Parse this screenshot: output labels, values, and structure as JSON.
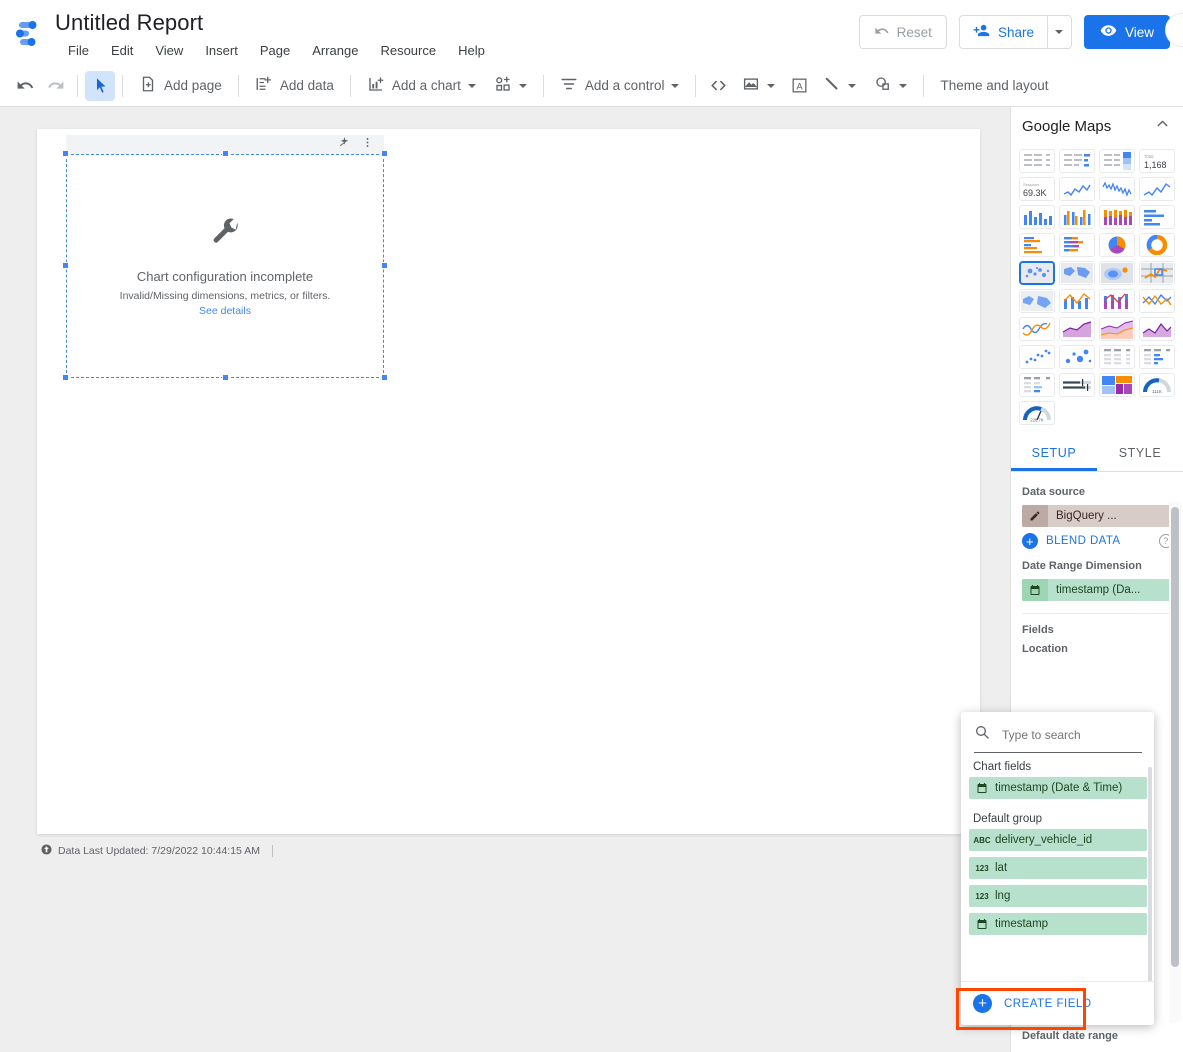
{
  "app": {
    "logo_icon": "looker-studio-logo",
    "title": "Untitled Report",
    "menu": [
      "File",
      "Edit",
      "View",
      "Insert",
      "Page",
      "Arrange",
      "Resource",
      "Help"
    ],
    "buttons": {
      "reset": "Reset",
      "reset_icon": "undo-arrow-icon",
      "share": "Share",
      "share_icon": "person-add-icon",
      "share_caret_icon": "chevron-down-icon",
      "view": "View",
      "view_icon": "eye-icon",
      "avatar_icon": "user-avatar"
    }
  },
  "toolbar": {
    "undo_icon": "undo-icon",
    "redo_icon": "redo-icon",
    "select_icon": "cursor-arrow-icon",
    "add_page": "Add page",
    "add_page_icon": "page-add-icon",
    "add_data": "Add data",
    "add_data_icon": "database-add-icon",
    "add_chart": "Add a chart",
    "add_chart_icon": "bar-chart-add-icon",
    "community_viz_icon": "community-visualization-icon",
    "add_control": "Add a control",
    "add_control_icon": "filter-control-icon",
    "embed_icon": "embed-code-icon",
    "image_icon": "image-icon",
    "text_icon": "text-box-icon",
    "line_icon": "line-icon",
    "shape_icon": "shape-icon",
    "theme_layout": "Theme and layout"
  },
  "canvas": {
    "chart_widget": {
      "magic_icon": "sparkle-wand-icon",
      "more_icon": "more-vert-icon",
      "placeholder_icon": "wrench-icon",
      "title": "Chart configuration incomplete",
      "subtitle": "Invalid/Missing dimensions, metrics, or filters.",
      "link": "See details"
    },
    "footer": {
      "icon": "refresh-data-icon",
      "text": "Data Last Updated: 7/29/2022 10:44:15 AM"
    }
  },
  "right_panel": {
    "header": {
      "title": "Google Maps",
      "collapse_icon": "chevron-up-icon"
    },
    "gallery": [
      {
        "name": "table",
        "selected": false
      },
      {
        "name": "table-with-bars",
        "selected": false
      },
      {
        "name": "table-with-heatmap",
        "selected": false
      },
      {
        "name": "scorecard-total",
        "selected": false,
        "label_top": "Total",
        "label_value": "1,168"
      },
      {
        "name": "scorecard-sessions",
        "selected": false,
        "label_top": "Sessions",
        "label_value": "69.3K"
      },
      {
        "name": "time-series-line",
        "selected": false
      },
      {
        "name": "time-series-multi",
        "selected": false
      },
      {
        "name": "sparkline",
        "selected": false
      },
      {
        "name": "column-chart",
        "selected": false
      },
      {
        "name": "column-chart-grouped",
        "selected": false
      },
      {
        "name": "stacked-column-chart",
        "selected": false
      },
      {
        "name": "bar-chart",
        "selected": false
      },
      {
        "name": "bar-chart-grouped",
        "selected": false
      },
      {
        "name": "stacked-bar-chart",
        "selected": false
      },
      {
        "name": "pie-chart",
        "selected": false
      },
      {
        "name": "donut-chart",
        "selected": false
      },
      {
        "name": "bubble-map",
        "selected": true
      },
      {
        "name": "filled-map",
        "selected": false
      },
      {
        "name": "google-maps-heatmap",
        "selected": false
      },
      {
        "name": "google-maps-line",
        "selected": false
      },
      {
        "name": "google-maps-filled",
        "selected": false
      },
      {
        "name": "combo-chart",
        "selected": false
      },
      {
        "name": "combo-stacked-chart",
        "selected": false
      },
      {
        "name": "line-chart",
        "selected": false
      },
      {
        "name": "smoothed-line-chart",
        "selected": false
      },
      {
        "name": "area-chart",
        "selected": false
      },
      {
        "name": "stacked-area-chart",
        "selected": false
      },
      {
        "name": "area-chart-multi",
        "selected": false
      },
      {
        "name": "scatter-chart",
        "selected": false
      },
      {
        "name": "bubble-chart",
        "selected": false
      },
      {
        "name": "pivot-table",
        "selected": false
      },
      {
        "name": "pivot-table-bars",
        "selected": false
      },
      {
        "name": "pivot-table-heatmap",
        "selected": false
      },
      {
        "name": "bullet-chart",
        "selected": false
      },
      {
        "name": "treemap",
        "selected": false
      },
      {
        "name": "gauge-111k",
        "selected": false,
        "label_value": "111K"
      },
      {
        "name": "gauge-22874",
        "selected": false,
        "label_value": "228.7K"
      }
    ],
    "tabs": [
      {
        "label": "SETUP",
        "active": true
      },
      {
        "label": "STYLE",
        "active": false
      }
    ],
    "setup": {
      "data_source_label": "Data source",
      "data_source_value": "BigQuery ...",
      "data_source_icon": "pencil-icon",
      "blend_data": "BLEND DATA",
      "blend_help_icon": "help-circle-icon",
      "date_range_label": "Date Range Dimension",
      "date_range_value": "timestamp (Da...",
      "date_range_icon": "calendar-icon",
      "fields_label": "Fields",
      "location_label": "Location",
      "default_date_range_label": "Default date range"
    }
  },
  "field_picker": {
    "search_placeholder": "Type to search",
    "search_value": "",
    "search_icon": "search-icon",
    "groups": [
      {
        "label": "Chart fields",
        "fields": [
          {
            "name": "timestamp (Date & Time)",
            "type_icon": "calendar-icon",
            "type": "date"
          }
        ]
      },
      {
        "label": "Default group",
        "fields": [
          {
            "name": "delivery_vehicle_id",
            "type_icon": "abc-icon",
            "type": "text"
          },
          {
            "name": "lat",
            "type_icon": "123-icon",
            "type": "number"
          },
          {
            "name": "lng",
            "type_icon": "123-icon",
            "type": "number"
          },
          {
            "name": "timestamp",
            "type_icon": "calendar-icon",
            "type": "date"
          }
        ]
      }
    ],
    "create_field": "CREATE FIELD",
    "create_field_icon": "plus-circle-icon",
    "highlight_color": "#ff4500"
  },
  "colors": {
    "accent_blue": "#1a73e8",
    "chip_green": "#b7e1cd",
    "chip_brown": "#d7ccc8",
    "highlight_orange": "#ff4500",
    "canvas_gray": "#eeeeee"
  }
}
